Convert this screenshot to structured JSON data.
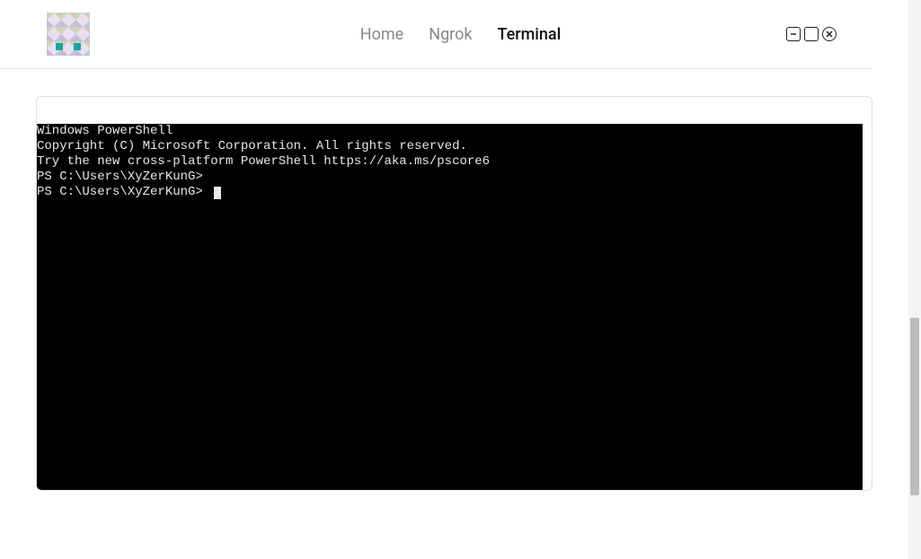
{
  "nav": {
    "items": [
      {
        "label": "Home",
        "active": false
      },
      {
        "label": "Ngrok",
        "active": false
      },
      {
        "label": "Terminal",
        "active": true
      }
    ]
  },
  "window_controls": {
    "minimize": "minimize",
    "maximize": "maximize",
    "close": "close"
  },
  "terminal": {
    "lines": [
      "Windows PowerShell",
      "Copyright (C) Microsoft Corporation. All rights reserved.",
      "",
      "Try the new cross-platform PowerShell https://aka.ms/pscore6",
      "",
      "PS C:\\Users\\XyZerKunG>",
      "PS C:\\Users\\XyZerKunG> "
    ]
  }
}
